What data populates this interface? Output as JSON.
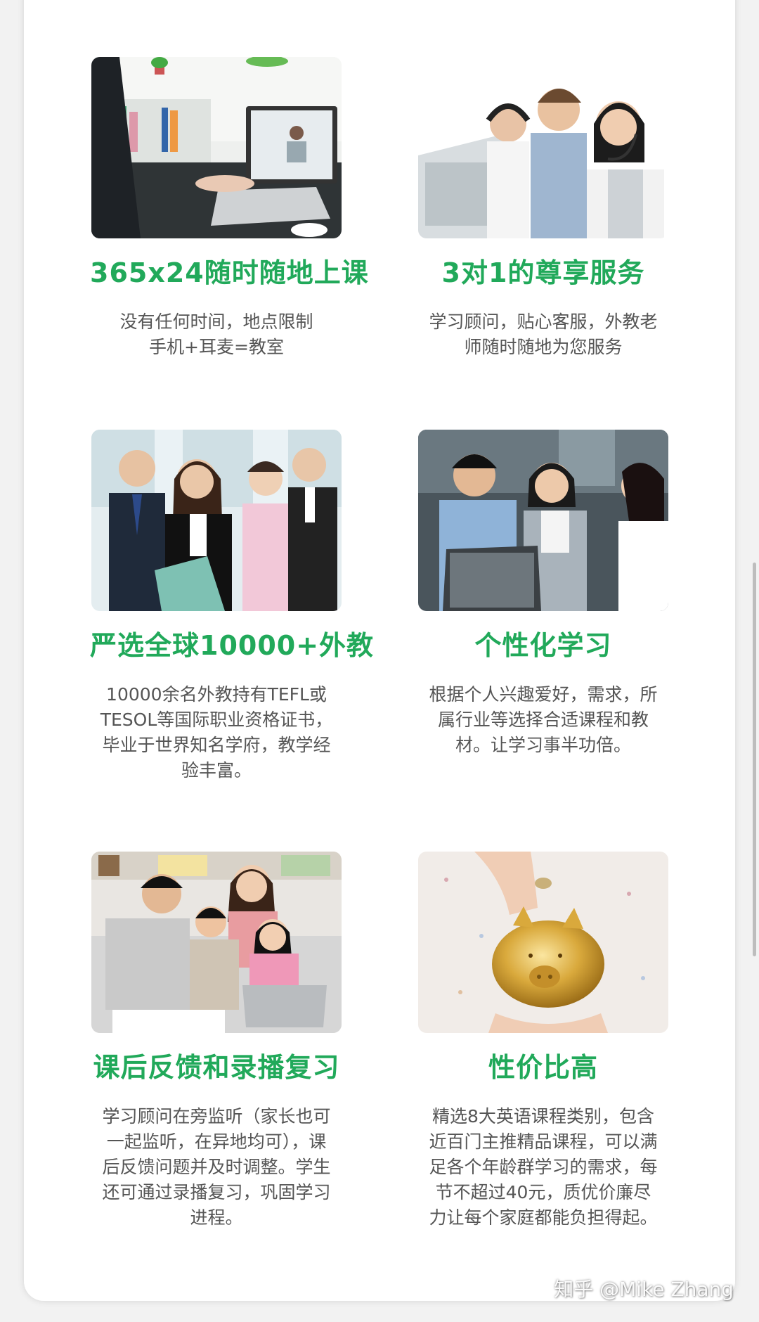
{
  "features": [
    {
      "title": "365x24随时随地上课",
      "desc": [
        "没有任何时间，地点限制",
        "手机+耳麦=教室"
      ]
    },
    {
      "title": "3对1的尊享服务",
      "desc": [
        "学习顾问，贴心客服，外教老",
        "师随时随地为您服务"
      ]
    },
    {
      "title": "严选全球10000+外教",
      "desc": [
        "10000余名外教持有TEFL或",
        "TESOL等国际职业资格证书，",
        "毕业于世界知名学府，教学经",
        "验丰富。"
      ]
    },
    {
      "title": "个性化学习",
      "desc": [
        "根据个人兴趣爱好，需求，所",
        "属行业等选择合适课程和教",
        "材。让学习事半功倍。"
      ]
    },
    {
      "title": "课后反馈和录播复习",
      "desc": [
        "学习顾问在旁监听（家长也可",
        "一起监听，在异地均可），课",
        "后反馈问题并及时调整。学生",
        "还可通过录播复习，巩固学习",
        "进程。"
      ]
    },
    {
      "title": "性价比高",
      "desc": [
        "精选8大英语课程类别，包含",
        "近百门主推精品课程，可以满",
        "足各个年龄群学习的需求，每",
        "节不超过40元，质优价廉尽",
        "力让每个家庭都能负担得起。"
      ]
    }
  ],
  "watermark": "知乎 @Mike Zhang",
  "colors": {
    "title": "#21a95a",
    "text": "#555555",
    "background": "#f2f2f2"
  }
}
